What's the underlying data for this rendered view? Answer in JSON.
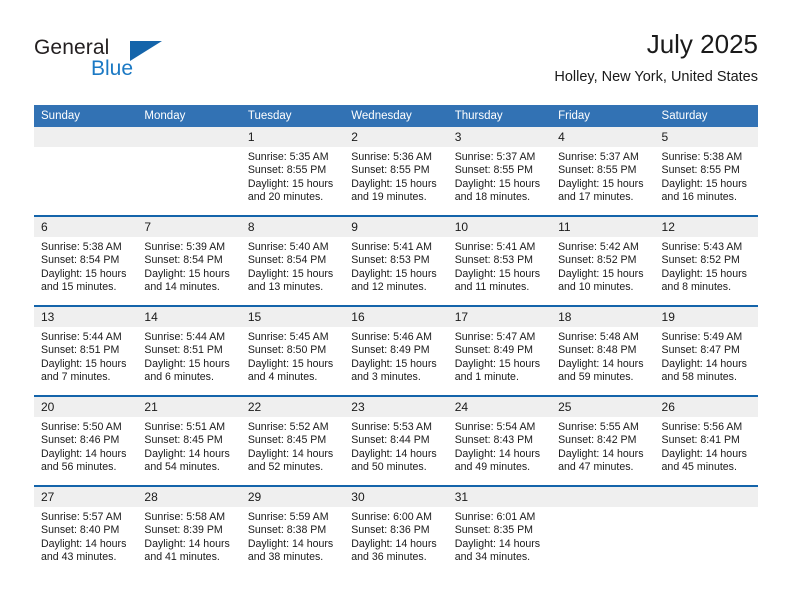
{
  "brand": {
    "name_part1": "General",
    "name_part2": "Blue",
    "logo_icon": "blue-triangle-icon",
    "accent_color": "#1464aa"
  },
  "header": {
    "title": "July 2025",
    "location": "Holley, New York, United States"
  },
  "calendar": {
    "header_bg": "#3272b4",
    "row_border_color": "#1464aa",
    "daynum_bg": "#efefef",
    "weekday_names": [
      "Sunday",
      "Monday",
      "Tuesday",
      "Wednesday",
      "Thursday",
      "Friday",
      "Saturday"
    ],
    "weeks": [
      [
        {
          "day": "",
          "empty": true
        },
        {
          "day": "",
          "empty": true
        },
        {
          "day": "1",
          "sunrise": "Sunrise: 5:35 AM",
          "sunset": "Sunset: 8:55 PM",
          "daylight": "Daylight: 15 hours and 20 minutes."
        },
        {
          "day": "2",
          "sunrise": "Sunrise: 5:36 AM",
          "sunset": "Sunset: 8:55 PM",
          "daylight": "Daylight: 15 hours and 19 minutes."
        },
        {
          "day": "3",
          "sunrise": "Sunrise: 5:37 AM",
          "sunset": "Sunset: 8:55 PM",
          "daylight": "Daylight: 15 hours and 18 minutes."
        },
        {
          "day": "4",
          "sunrise": "Sunrise: 5:37 AM",
          "sunset": "Sunset: 8:55 PM",
          "daylight": "Daylight: 15 hours and 17 minutes."
        },
        {
          "day": "5",
          "sunrise": "Sunrise: 5:38 AM",
          "sunset": "Sunset: 8:55 PM",
          "daylight": "Daylight: 15 hours and 16 minutes."
        }
      ],
      [
        {
          "day": "6",
          "sunrise": "Sunrise: 5:38 AM",
          "sunset": "Sunset: 8:54 PM",
          "daylight": "Daylight: 15 hours and 15 minutes."
        },
        {
          "day": "7",
          "sunrise": "Sunrise: 5:39 AM",
          "sunset": "Sunset: 8:54 PM",
          "daylight": "Daylight: 15 hours and 14 minutes."
        },
        {
          "day": "8",
          "sunrise": "Sunrise: 5:40 AM",
          "sunset": "Sunset: 8:54 PM",
          "daylight": "Daylight: 15 hours and 13 minutes."
        },
        {
          "day": "9",
          "sunrise": "Sunrise: 5:41 AM",
          "sunset": "Sunset: 8:53 PM",
          "daylight": "Daylight: 15 hours and 12 minutes."
        },
        {
          "day": "10",
          "sunrise": "Sunrise: 5:41 AM",
          "sunset": "Sunset: 8:53 PM",
          "daylight": "Daylight: 15 hours and 11 minutes."
        },
        {
          "day": "11",
          "sunrise": "Sunrise: 5:42 AM",
          "sunset": "Sunset: 8:52 PM",
          "daylight": "Daylight: 15 hours and 10 minutes."
        },
        {
          "day": "12",
          "sunrise": "Sunrise: 5:43 AM",
          "sunset": "Sunset: 8:52 PM",
          "daylight": "Daylight: 15 hours and 8 minutes."
        }
      ],
      [
        {
          "day": "13",
          "sunrise": "Sunrise: 5:44 AM",
          "sunset": "Sunset: 8:51 PM",
          "daylight": "Daylight: 15 hours and 7 minutes."
        },
        {
          "day": "14",
          "sunrise": "Sunrise: 5:44 AM",
          "sunset": "Sunset: 8:51 PM",
          "daylight": "Daylight: 15 hours and 6 minutes."
        },
        {
          "day": "15",
          "sunrise": "Sunrise: 5:45 AM",
          "sunset": "Sunset: 8:50 PM",
          "daylight": "Daylight: 15 hours and 4 minutes."
        },
        {
          "day": "16",
          "sunrise": "Sunrise: 5:46 AM",
          "sunset": "Sunset: 8:49 PM",
          "daylight": "Daylight: 15 hours and 3 minutes."
        },
        {
          "day": "17",
          "sunrise": "Sunrise: 5:47 AM",
          "sunset": "Sunset: 8:49 PM",
          "daylight": "Daylight: 15 hours and 1 minute."
        },
        {
          "day": "18",
          "sunrise": "Sunrise: 5:48 AM",
          "sunset": "Sunset: 8:48 PM",
          "daylight": "Daylight: 14 hours and 59 minutes."
        },
        {
          "day": "19",
          "sunrise": "Sunrise: 5:49 AM",
          "sunset": "Sunset: 8:47 PM",
          "daylight": "Daylight: 14 hours and 58 minutes."
        }
      ],
      [
        {
          "day": "20",
          "sunrise": "Sunrise: 5:50 AM",
          "sunset": "Sunset: 8:46 PM",
          "daylight": "Daylight: 14 hours and 56 minutes."
        },
        {
          "day": "21",
          "sunrise": "Sunrise: 5:51 AM",
          "sunset": "Sunset: 8:45 PM",
          "daylight": "Daylight: 14 hours and 54 minutes."
        },
        {
          "day": "22",
          "sunrise": "Sunrise: 5:52 AM",
          "sunset": "Sunset: 8:45 PM",
          "daylight": "Daylight: 14 hours and 52 minutes."
        },
        {
          "day": "23",
          "sunrise": "Sunrise: 5:53 AM",
          "sunset": "Sunset: 8:44 PM",
          "daylight": "Daylight: 14 hours and 50 minutes."
        },
        {
          "day": "24",
          "sunrise": "Sunrise: 5:54 AM",
          "sunset": "Sunset: 8:43 PM",
          "daylight": "Daylight: 14 hours and 49 minutes."
        },
        {
          "day": "25",
          "sunrise": "Sunrise: 5:55 AM",
          "sunset": "Sunset: 8:42 PM",
          "daylight": "Daylight: 14 hours and 47 minutes."
        },
        {
          "day": "26",
          "sunrise": "Sunrise: 5:56 AM",
          "sunset": "Sunset: 8:41 PM",
          "daylight": "Daylight: 14 hours and 45 minutes."
        }
      ],
      [
        {
          "day": "27",
          "sunrise": "Sunrise: 5:57 AM",
          "sunset": "Sunset: 8:40 PM",
          "daylight": "Daylight: 14 hours and 43 minutes."
        },
        {
          "day": "28",
          "sunrise": "Sunrise: 5:58 AM",
          "sunset": "Sunset: 8:39 PM",
          "daylight": "Daylight: 14 hours and 41 minutes."
        },
        {
          "day": "29",
          "sunrise": "Sunrise: 5:59 AM",
          "sunset": "Sunset: 8:38 PM",
          "daylight": "Daylight: 14 hours and 38 minutes."
        },
        {
          "day": "30",
          "sunrise": "Sunrise: 6:00 AM",
          "sunset": "Sunset: 8:36 PM",
          "daylight": "Daylight: 14 hours and 36 minutes."
        },
        {
          "day": "31",
          "sunrise": "Sunrise: 6:01 AM",
          "sunset": "Sunset: 8:35 PM",
          "daylight": "Daylight: 14 hours and 34 minutes."
        },
        {
          "day": "",
          "empty": true
        },
        {
          "day": "",
          "empty": true
        }
      ]
    ]
  }
}
